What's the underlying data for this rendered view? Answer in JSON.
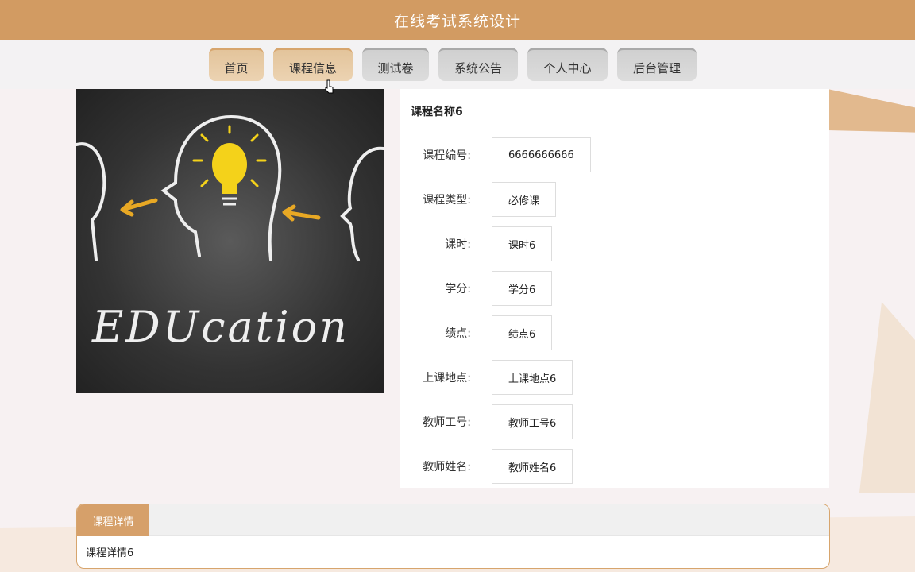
{
  "header": {
    "title": "在线考试系统设计"
  },
  "nav": {
    "items": [
      {
        "label": "首页"
      },
      {
        "label": "课程信息"
      },
      {
        "label": "测试卷"
      },
      {
        "label": "系统公告"
      },
      {
        "label": "个人中心"
      },
      {
        "label": "后台管理"
      }
    ]
  },
  "course": {
    "image_text": "EDUcation",
    "name": "课程名称6",
    "fields": [
      {
        "label": "课程编号:",
        "value": "6666666666"
      },
      {
        "label": "课程类型:",
        "value": "必修课"
      },
      {
        "label": "课时:",
        "value": "课时6"
      },
      {
        "label": "学分:",
        "value": "学分6"
      },
      {
        "label": "绩点:",
        "value": "绩点6"
      },
      {
        "label": "上课地点:",
        "value": "上课地点6"
      },
      {
        "label": "教师工号:",
        "value": "教师工号6"
      },
      {
        "label": "教师姓名:",
        "value": "教师姓名6"
      }
    ]
  },
  "detail": {
    "tab_label": "课程详情",
    "content": "课程详情6"
  },
  "colors": {
    "accent": "#d29b62",
    "nav_active": "#e3c49b",
    "nav_inactive": "#d3d3d3"
  },
  "icons": [
    "lightbulb-head-icon",
    "arrow-icon",
    "cursor-icon"
  ]
}
